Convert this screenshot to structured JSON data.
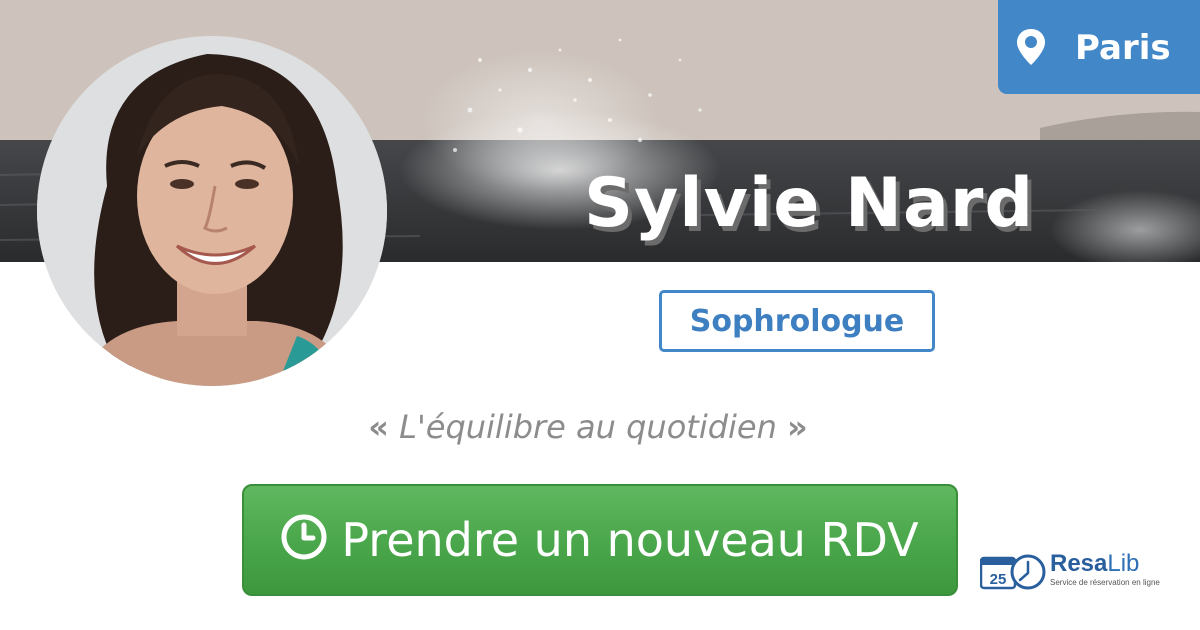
{
  "banner": {
    "image": "ocean-wave-splash-photo"
  },
  "location": {
    "icon": "map-pin-icon",
    "label": "Paris",
    "color": "#4287c8"
  },
  "profile": {
    "name": "Sylvie Nard",
    "profession": "Sophrologue",
    "avatar": "portrait-photo",
    "motto": {
      "open_quote": "«",
      "text": "L'équilibre au quotidien",
      "close_quote": "»"
    }
  },
  "cta": {
    "icon": "clock-icon",
    "label": "Prendre un nouveau RDV",
    "color": "#4aa64a"
  },
  "brand": {
    "calendar_number": "25",
    "name_part1": "Resa",
    "name_part2": "Lib",
    "tagline": "Service de réservation en ligne",
    "color": "#2a5f9e"
  }
}
